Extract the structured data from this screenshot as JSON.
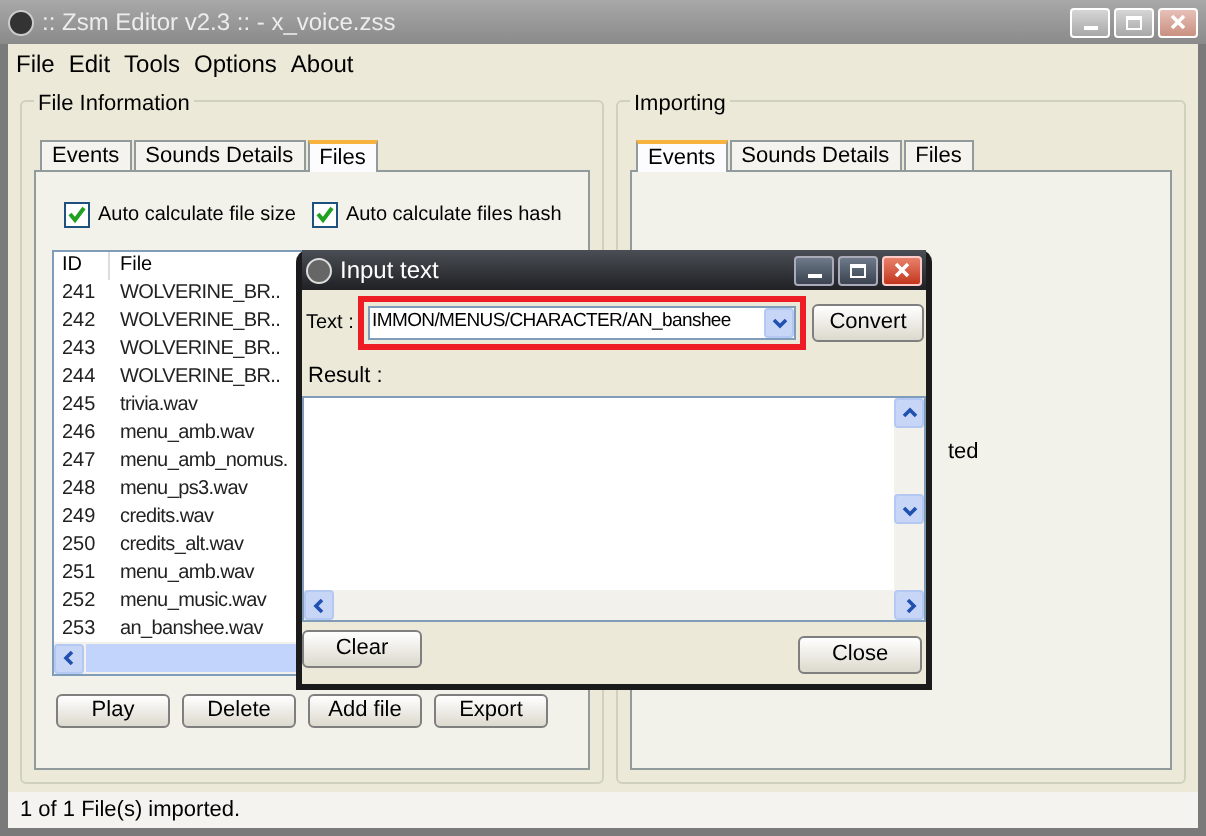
{
  "window": {
    "title": ":: Zsm Editor v2.3 :: - x_voice.zss"
  },
  "menu": [
    "File",
    "Edit",
    "Tools",
    "Options",
    "About"
  ],
  "file_information": {
    "title": "File Information",
    "tabs": [
      {
        "label": "Events",
        "selected": false
      },
      {
        "label": "Sounds Details",
        "selected": false
      },
      {
        "label": "Files",
        "selected": true
      }
    ],
    "checkboxes": [
      {
        "label": "Auto calculate file size",
        "checked": true
      },
      {
        "label": "Auto calculate files hash",
        "checked": true
      }
    ],
    "table": {
      "columns": [
        "ID",
        "File"
      ],
      "rows": [
        [
          "241",
          "WOLVERINE_BR.."
        ],
        [
          "242",
          "WOLVERINE_BR.."
        ],
        [
          "243",
          "WOLVERINE_BR.."
        ],
        [
          "244",
          "WOLVERINE_BR.."
        ],
        [
          "245",
          "trivia.wav"
        ],
        [
          "246",
          "menu_amb.wav"
        ],
        [
          "247",
          "menu_amb_nomus."
        ],
        [
          "248",
          "menu_ps3.wav"
        ],
        [
          "249",
          "credits.wav"
        ],
        [
          "250",
          "credits_alt.wav"
        ],
        [
          "251",
          "menu_amb.wav"
        ],
        [
          "252",
          "menu_music.wav"
        ],
        [
          "253",
          "an_banshee.wav"
        ]
      ]
    },
    "buttons": [
      "Play",
      "Delete",
      "Add file",
      "Export"
    ]
  },
  "importing": {
    "title": "Importing",
    "tabs": [
      {
        "label": "Events",
        "selected": true
      },
      {
        "label": "Sounds Details",
        "selected": false
      },
      {
        "label": "Files",
        "selected": false
      }
    ],
    "partial_text": "ted"
  },
  "dialog": {
    "title": "Input text",
    "text_label": "Text :",
    "text_value": "IMMON/MENUS/CHARACTER/AN_banshee",
    "convert": "Convert",
    "result_label": "Result :",
    "clear": "Clear",
    "close": "Close"
  },
  "status_bar": "1 of 1 File(s) imported."
}
